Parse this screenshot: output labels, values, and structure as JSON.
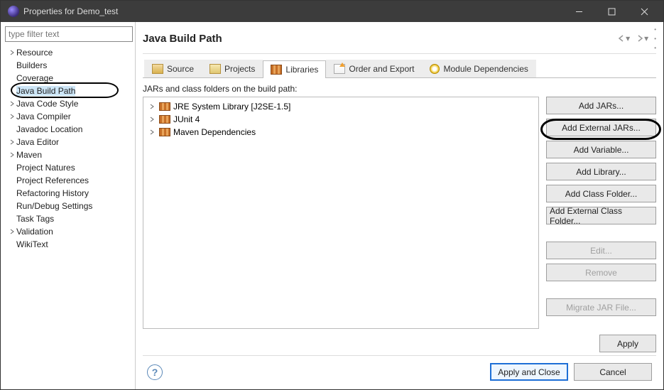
{
  "window": {
    "title": "Properties for Demo_test"
  },
  "sidebar": {
    "filter_placeholder": "type filter text",
    "items": [
      {
        "label": "Resource",
        "expandable": true
      },
      {
        "label": "Builders",
        "expandable": false
      },
      {
        "label": "Coverage",
        "expandable": false
      },
      {
        "label": "Java Build Path",
        "expandable": false,
        "selected": true,
        "circled": true
      },
      {
        "label": "Java Code Style",
        "expandable": true
      },
      {
        "label": "Java Compiler",
        "expandable": true
      },
      {
        "label": "Javadoc Location",
        "expandable": false
      },
      {
        "label": "Java Editor",
        "expandable": true
      },
      {
        "label": "Maven",
        "expandable": true
      },
      {
        "label": "Project Natures",
        "expandable": false
      },
      {
        "label": "Project References",
        "expandable": false
      },
      {
        "label": "Refactoring History",
        "expandable": false
      },
      {
        "label": "Run/Debug Settings",
        "expandable": false
      },
      {
        "label": "Task Tags",
        "expandable": false
      },
      {
        "label": "Validation",
        "expandable": true
      },
      {
        "label": "WikiText",
        "expandable": false
      }
    ]
  },
  "main": {
    "heading": "Java Build Path",
    "tabs": [
      {
        "label": "Source",
        "iconClass": "src"
      },
      {
        "label": "Projects",
        "iconClass": "prj"
      },
      {
        "label": "Libraries",
        "iconClass": "lib",
        "active": true
      },
      {
        "label": "Order and Export",
        "iconClass": "ord"
      },
      {
        "label": "Module Dependencies",
        "iconClass": "mod"
      }
    ],
    "libs_label": "JARs and class folders on the build path:",
    "lib_entries": [
      {
        "label": "JRE System Library [J2SE-1.5]"
      },
      {
        "label": "JUnit 4"
      },
      {
        "label": "Maven Dependencies"
      }
    ],
    "buttons": {
      "add_jars": "Add JARs...",
      "add_ext_jars": "Add External JARs...",
      "add_variable": "Add Variable...",
      "add_library": "Add Library...",
      "add_class_folder": "Add Class Folder...",
      "add_ext_class_folder": "Add External Class Folder...",
      "edit": "Edit...",
      "remove": "Remove",
      "migrate": "Migrate JAR File...",
      "apply": "Apply"
    }
  },
  "footer": {
    "apply_close": "Apply and Close",
    "cancel": "Cancel"
  }
}
